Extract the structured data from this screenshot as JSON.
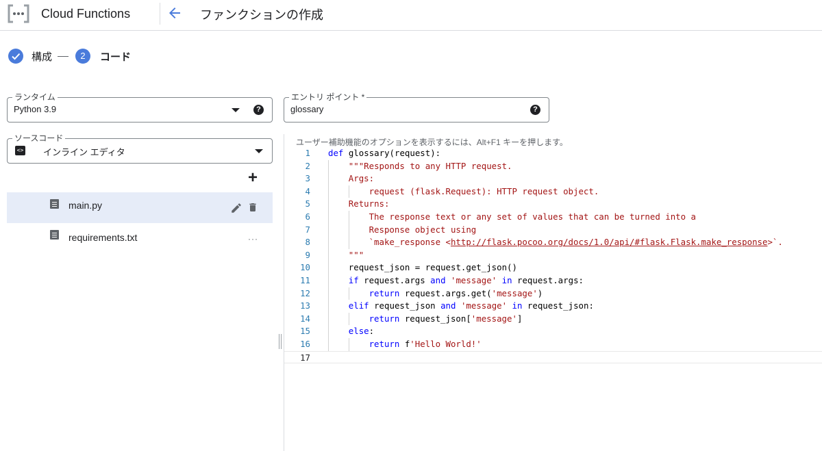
{
  "header": {
    "app_title": "Cloud Functions",
    "page_title": "ファンクションの作成"
  },
  "stepper": {
    "step1_label": "構成",
    "step2_number": "2",
    "step2_label": "コード"
  },
  "runtime": {
    "label": "ランタイム",
    "value": "Python 3.9",
    "help": "?"
  },
  "entry_point": {
    "label": "エントリ ポイント *",
    "value": "glossary",
    "help": "?"
  },
  "source_code": {
    "label": "ソースコード",
    "icon_glyph": "<>",
    "value": "インライン エディタ"
  },
  "files": {
    "add_label": "+",
    "items": [
      {
        "name": "main.py",
        "selected": true
      },
      {
        "name": "requirements.txt",
        "selected": false,
        "more": "···"
      }
    ]
  },
  "editor": {
    "a11y_hint": "ユーザー補助機能のオプションを表示するには、Alt+F1 キーを押します。",
    "lines": [
      {
        "n": "1",
        "indent": 0,
        "tokens": [
          [
            "kw",
            "def"
          ],
          [
            "plain",
            " glossary(request):"
          ]
        ]
      },
      {
        "n": "2",
        "indent": 1,
        "tokens": [
          [
            "str",
            "\"\"\"Responds to any HTTP request."
          ]
        ]
      },
      {
        "n": "3",
        "indent": 1,
        "tokens": [
          [
            "str",
            "Args:"
          ]
        ]
      },
      {
        "n": "4",
        "indent": 2,
        "tokens": [
          [
            "str",
            "request (flask.Request): HTTP request object."
          ]
        ]
      },
      {
        "n": "5",
        "indent": 1,
        "tokens": [
          [
            "str",
            "Returns:"
          ]
        ]
      },
      {
        "n": "6",
        "indent": 2,
        "tokens": [
          [
            "str",
            "The response text or any set of values that can be turned into a"
          ]
        ]
      },
      {
        "n": "7",
        "indent": 2,
        "tokens": [
          [
            "str",
            "Response object using"
          ]
        ]
      },
      {
        "n": "8",
        "indent": 2,
        "tokens": [
          [
            "str",
            "`make_response <"
          ],
          [
            "url",
            "http://flask.pocoo.org/docs/1.0/api/#flask.Flask.make_response"
          ],
          [
            "str",
            ">`."
          ]
        ]
      },
      {
        "n": "9",
        "indent": 1,
        "tokens": [
          [
            "str",
            "\"\"\""
          ]
        ]
      },
      {
        "n": "10",
        "indent": 1,
        "tokens": [
          [
            "plain",
            "request_json = request.get_json()"
          ]
        ]
      },
      {
        "n": "11",
        "indent": 1,
        "tokens": [
          [
            "kw",
            "if"
          ],
          [
            "plain",
            " request.args "
          ],
          [
            "kw",
            "and"
          ],
          [
            "plain",
            " "
          ],
          [
            "str",
            "'message'"
          ],
          [
            "plain",
            " "
          ],
          [
            "kw",
            "in"
          ],
          [
            "plain",
            " request.args:"
          ]
        ]
      },
      {
        "n": "12",
        "indent": 2,
        "tokens": [
          [
            "kw",
            "return"
          ],
          [
            "plain",
            " request.args.get("
          ],
          [
            "str",
            "'message'"
          ],
          [
            "plain",
            ")"
          ]
        ]
      },
      {
        "n": "13",
        "indent": 1,
        "tokens": [
          [
            "kw",
            "elif"
          ],
          [
            "plain",
            " request_json "
          ],
          [
            "kw",
            "and"
          ],
          [
            "plain",
            " "
          ],
          [
            "str",
            "'message'"
          ],
          [
            "plain",
            " "
          ],
          [
            "kw",
            "in"
          ],
          [
            "plain",
            " request_json:"
          ]
        ]
      },
      {
        "n": "14",
        "indent": 2,
        "tokens": [
          [
            "kw",
            "return"
          ],
          [
            "plain",
            " request_json["
          ],
          [
            "str",
            "'message'"
          ],
          [
            "plain",
            "]"
          ]
        ]
      },
      {
        "n": "15",
        "indent": 1,
        "tokens": [
          [
            "kw",
            "else"
          ],
          [
            "plain",
            ":"
          ]
        ]
      },
      {
        "n": "16",
        "indent": 2,
        "tokens": [
          [
            "kw",
            "return"
          ],
          [
            "plain",
            " f"
          ],
          [
            "str",
            "'Hello World!'"
          ]
        ]
      },
      {
        "n": "17",
        "indent": 0,
        "tokens": []
      }
    ]
  },
  "colors": {
    "accent": "#4a7bdb",
    "keyword": "#0000ff",
    "string": "#a31515",
    "line_number": "#2b7bb0",
    "selected_row": "#e6ecf8"
  }
}
